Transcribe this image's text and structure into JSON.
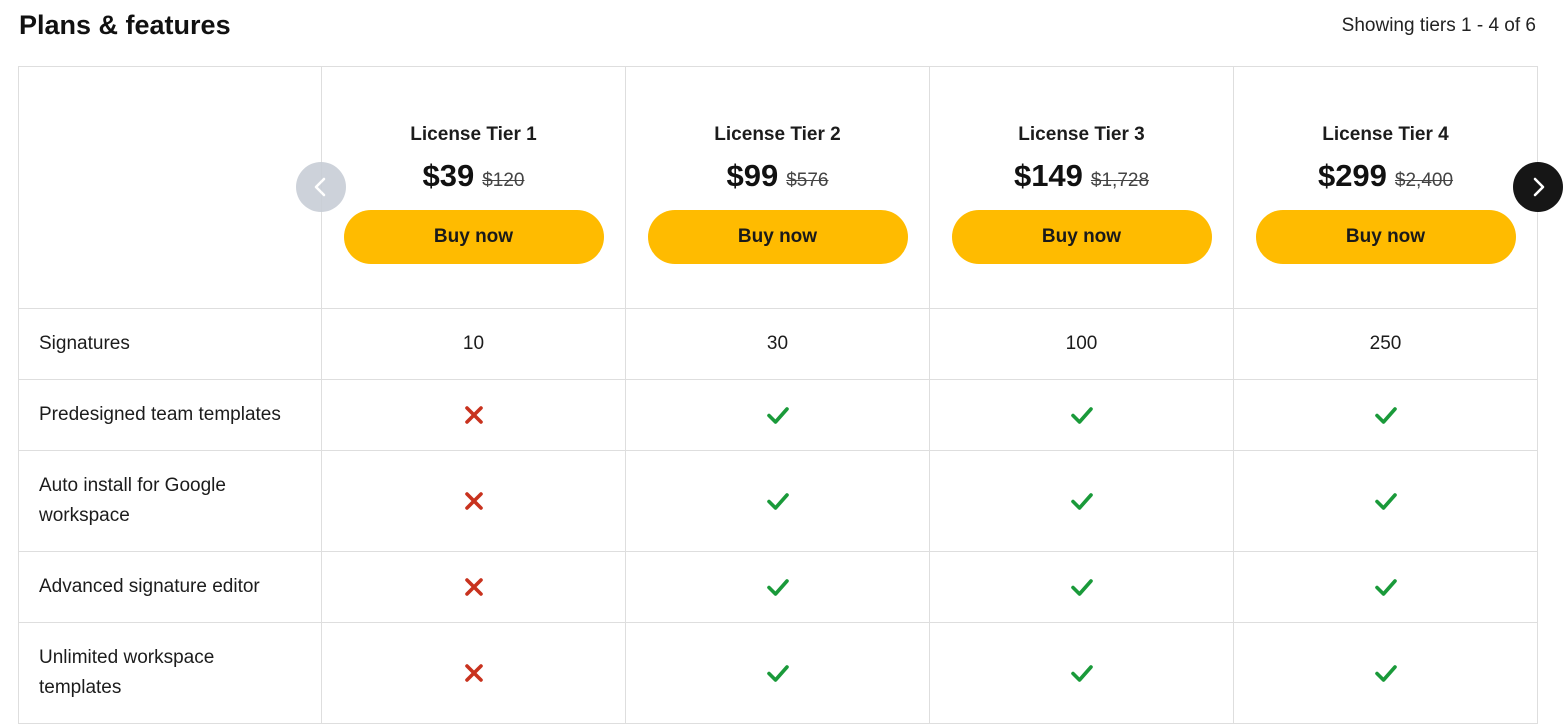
{
  "header": {
    "title": "Plans & features",
    "counter": "Showing tiers 1 - 4 of 6"
  },
  "tiers": [
    {
      "name": "License Tier 1",
      "price": "$39",
      "old_price": "$120",
      "cta": "Buy now"
    },
    {
      "name": "License Tier 2",
      "price": "$99",
      "old_price": "$576",
      "cta": "Buy now"
    },
    {
      "name": "License Tier 3",
      "price": "$149",
      "old_price": "$1,728",
      "cta": "Buy now"
    },
    {
      "name": "License Tier 4",
      "price": "$299",
      "old_price": "$2,400",
      "cta": "Buy now"
    }
  ],
  "features": [
    {
      "label": "Signatures",
      "values": [
        "10",
        "30",
        "100",
        "250"
      ]
    },
    {
      "label": "Predesigned team templates",
      "values": [
        "cross-icon",
        "check-icon",
        "check-icon",
        "check-icon"
      ]
    },
    {
      "label": "Auto install for Google workspace",
      "values": [
        "cross-icon",
        "check-icon",
        "check-icon",
        "check-icon"
      ]
    },
    {
      "label": "Advanced signature editor",
      "values": [
        "cross-icon",
        "check-icon",
        "check-icon",
        "check-icon"
      ]
    },
    {
      "label": "Unlimited workspace templates",
      "values": [
        "cross-icon",
        "check-icon",
        "check-icon",
        "check-icon"
      ]
    }
  ],
  "nav": {
    "prev_icon": "chevron-left-icon",
    "next_icon": "chevron-right-icon"
  },
  "colors": {
    "accent": "#ffbb00",
    "check": "#1a9a3a",
    "cross": "#c8321e",
    "nav_disabled": "#c8ced6",
    "nav_active": "#161616"
  }
}
